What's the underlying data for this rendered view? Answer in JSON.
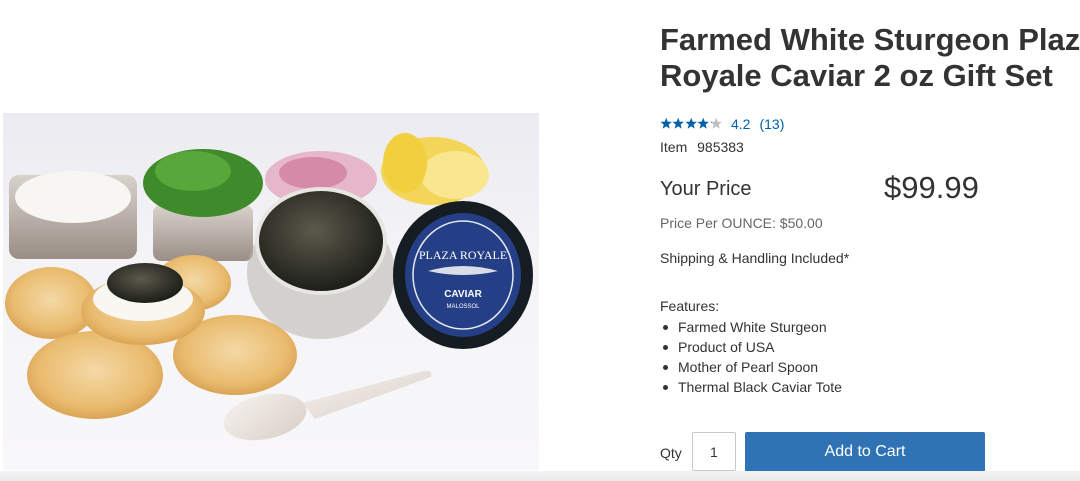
{
  "product": {
    "title_line1": "Farmed White Sturgeon Plaza",
    "title_line2": "Royale Caviar 2 oz Gift Set",
    "image_alt": "Farmed White Sturgeon Plaza Royale Caviar 2 oz Gift Set",
    "tin_brand": "PLAZA ROYALE",
    "tin_label": "CAVIAR",
    "tin_sublabel": "MALOSSOL"
  },
  "rating": {
    "value": "4.2",
    "review_count": "(13)",
    "fraction_filled": 0.84,
    "star_color": "#0060a9",
    "empty_star_color": "#bdbdbd"
  },
  "item": {
    "label": "Item",
    "number": "985383"
  },
  "price": {
    "label": "Your Price",
    "value": "$99.99",
    "per_unit": "Price Per OUNCE: $50.00"
  },
  "shipping": "Shipping & Handling Included*",
  "features": {
    "heading": "Features:",
    "items": [
      "Farmed White Sturgeon",
      "Product of USA",
      "Mother of Pearl Spoon",
      "Thermal Black Caviar Tote"
    ]
  },
  "purchase": {
    "qty_label": "Qty",
    "qty_value": "1",
    "add_to_cart_label": "Add to Cart",
    "button_color": "#3073b5"
  }
}
